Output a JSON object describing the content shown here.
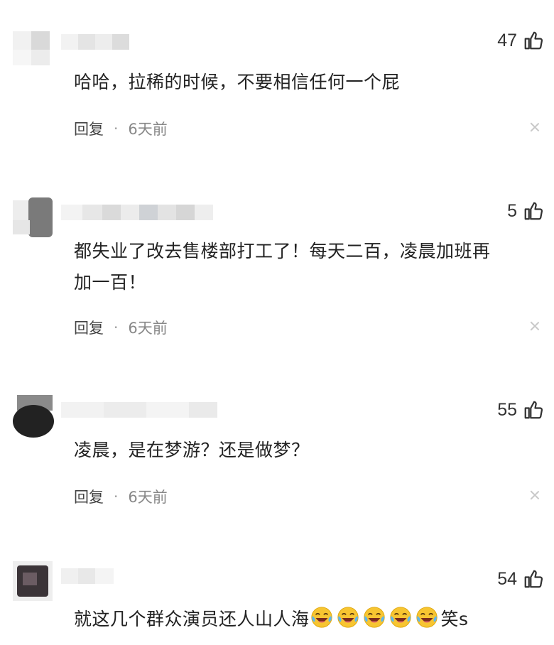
{
  "comments": [
    {
      "likes": "47",
      "text_lines": [
        "哈哈，拉稀的时候，不要相信任何一个屁"
      ],
      "reply_label": "回复",
      "separator": "·",
      "time": "6天前"
    },
    {
      "likes": "5",
      "text_lines": [
        "都失业了改去售楼部打工了！每天二百，凌晨加班再",
        "加一百！"
      ],
      "reply_label": "回复",
      "separator": "·",
      "time": "6天前"
    },
    {
      "likes": "55",
      "text_lines": [
        "凌晨，是在梦游？还是做梦？"
      ],
      "reply_label": "回复",
      "separator": "·",
      "time": "6天前"
    },
    {
      "likes": "54",
      "text_prefix": "就这几个群众演员还人山人海",
      "emoji_name": "laughing-crying-emoji",
      "emoji_count": 5,
      "text_suffix": "笑s"
    }
  ],
  "icons": {
    "like": "thumbs-up-icon",
    "close": "close-icon"
  },
  "colors": {
    "text": "#222222",
    "muted": "#888888",
    "divider": "#c8c8c8"
  }
}
